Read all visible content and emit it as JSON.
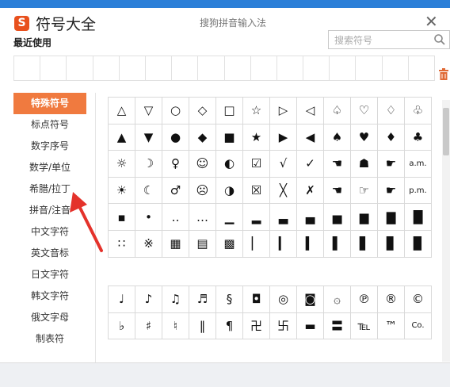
{
  "app": {
    "title": "符号大全",
    "subtitle": "搜狗拼音输入法",
    "logo_letter": "S",
    "close_glyph": "✕"
  },
  "recent": {
    "label": "最近使用",
    "cells": 16
  },
  "search": {
    "placeholder": "搜索符号"
  },
  "sidebar": {
    "items": [
      {
        "label": "特殊符号",
        "active": true
      },
      {
        "label": "标点符号"
      },
      {
        "label": "数字序号"
      },
      {
        "label": "数学/单位"
      },
      {
        "label": "希腊/拉丁"
      },
      {
        "label": "拼音/注音"
      },
      {
        "label": "中文字符"
      },
      {
        "label": "英文音标"
      },
      {
        "label": "日文字符"
      },
      {
        "label": "韩文字符"
      },
      {
        "label": "俄文字母"
      },
      {
        "label": "制表符"
      }
    ]
  },
  "grid1": [
    "△",
    "▽",
    "○",
    "◇",
    "□",
    "☆",
    "▷",
    "◁",
    "♤",
    "♡",
    "♢",
    "♧",
    "▲",
    "▼",
    "●",
    "◆",
    "■",
    "★",
    "▶",
    "◀",
    "♠",
    "♥",
    "♦",
    "♣",
    "☼",
    "☽",
    "♀",
    "☺",
    "◐",
    "☑",
    "√",
    "✓",
    "☚",
    "☗",
    "☛",
    "a.m.",
    "☀",
    "☾",
    "♂",
    "☹",
    "◑",
    "☒",
    "╳",
    "✗",
    "☚",
    "☞",
    "☛",
    "p.m.",
    "▪",
    "•",
    "‥",
    "…",
    "▁",
    "▂",
    "▃",
    "▄",
    "▅",
    "▆",
    "▇",
    "█",
    "∷",
    "※",
    "▦",
    "▤",
    "▩",
    "▏",
    "▎",
    "▍",
    "▌",
    "▋",
    "▊",
    "▉"
  ],
  "grid2": [
    "♩",
    "♪",
    "♫",
    "♬",
    "§",
    "◘",
    "◎",
    "◙",
    "۞",
    "℗",
    "®",
    "©",
    "♭",
    "♯",
    "♮",
    "‖",
    "¶",
    "卍",
    "卐",
    "▬",
    "〓",
    "℡",
    "™",
    "Co."
  ],
  "colors": {
    "accent": "#f07a3f",
    "titlebar": "#2b7fd8",
    "trash": "#e06a35",
    "annotation_arrow": "#e4322b"
  },
  "icons": {
    "trash": "trash-icon",
    "search": "search-icon",
    "close": "close-icon"
  }
}
